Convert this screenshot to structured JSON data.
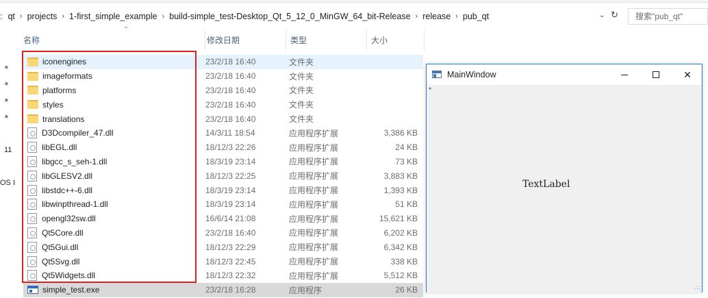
{
  "breadcrumb": {
    "items": [
      "qt",
      "projects",
      "1-first_simple_example",
      "build-simple_test-Desktop_Qt_5_12_0_MinGW_64_bit-Release",
      "release",
      "pub_qt"
    ],
    "leading_fragment": ":",
    "separator": "›"
  },
  "search": {
    "placeholder": "搜索\"pub_qt\""
  },
  "nav": {
    "clipped_labels": [
      "11",
      "OS I"
    ]
  },
  "columns": {
    "name": "名称",
    "date": "修改日期",
    "type": "类型",
    "size": "大小"
  },
  "files": [
    {
      "name": "iconengines",
      "date": "23/2/18 16:40",
      "type": "文件夹",
      "size": "",
      "icon": "folder-icon"
    },
    {
      "name": "imageformats",
      "date": "23/2/18 16:40",
      "type": "文件夹",
      "size": "",
      "icon": "folder-icon"
    },
    {
      "name": "platforms",
      "date": "23/2/18 16:40",
      "type": "文件夹",
      "size": "",
      "icon": "folder-icon"
    },
    {
      "name": "styles",
      "date": "23/2/18 16:40",
      "type": "文件夹",
      "size": "",
      "icon": "folder-icon"
    },
    {
      "name": "translations",
      "date": "23/2/18 16:40",
      "type": "文件夹",
      "size": "",
      "icon": "folder-icon"
    },
    {
      "name": "D3Dcompiler_47.dll",
      "date": "14/3/11 18:54",
      "type": "应用程序扩展",
      "size": "3,386 KB",
      "icon": "dll-icon"
    },
    {
      "name": "libEGL.dll",
      "date": "18/12/3 22:26",
      "type": "应用程序扩展",
      "size": "24 KB",
      "icon": "dll-icon"
    },
    {
      "name": "libgcc_s_seh-1.dll",
      "date": "18/3/19 23:14",
      "type": "应用程序扩展",
      "size": "73 KB",
      "icon": "dll-icon"
    },
    {
      "name": "libGLESV2.dll",
      "date": "18/12/3 22:25",
      "type": "应用程序扩展",
      "size": "3,883 KB",
      "icon": "dll-icon"
    },
    {
      "name": "libstdc++-6.dll",
      "date": "18/3/19 23:14",
      "type": "应用程序扩展",
      "size": "1,393 KB",
      "icon": "dll-icon"
    },
    {
      "name": "libwinpthread-1.dll",
      "date": "18/3/19 23:14",
      "type": "应用程序扩展",
      "size": "51 KB",
      "icon": "dll-icon"
    },
    {
      "name": "opengl32sw.dll",
      "date": "16/6/14 21:08",
      "type": "应用程序扩展",
      "size": "15,621 KB",
      "icon": "dll-icon"
    },
    {
      "name": "Qt5Core.dll",
      "date": "23/2/18 16:40",
      "type": "应用程序扩展",
      "size": "6,202 KB",
      "icon": "dll-icon"
    },
    {
      "name": "Qt5Gui.dll",
      "date": "18/12/3 22:29",
      "type": "应用程序扩展",
      "size": "6,342 KB",
      "icon": "dll-icon"
    },
    {
      "name": "Qt5Svg.dll",
      "date": "18/12/3 22:45",
      "type": "应用程序扩展",
      "size": "338 KB",
      "icon": "dll-icon"
    },
    {
      "name": "Qt5Widgets.dll",
      "date": "18/12/3 22:32",
      "type": "应用程序扩展",
      "size": "5,512 KB",
      "icon": "dll-icon"
    },
    {
      "name": "simple_test.exe",
      "date": "23/2/18 16:28",
      "type": "应用程序",
      "size": "26 KB",
      "icon": "exe-icon"
    }
  ],
  "main_window": {
    "title": "MainWindow",
    "label_text": "TextLabel"
  },
  "colors": {
    "highlight_border": "#e02020",
    "window_border": "#2b79d6",
    "selected_row": "#e5f3ff"
  }
}
